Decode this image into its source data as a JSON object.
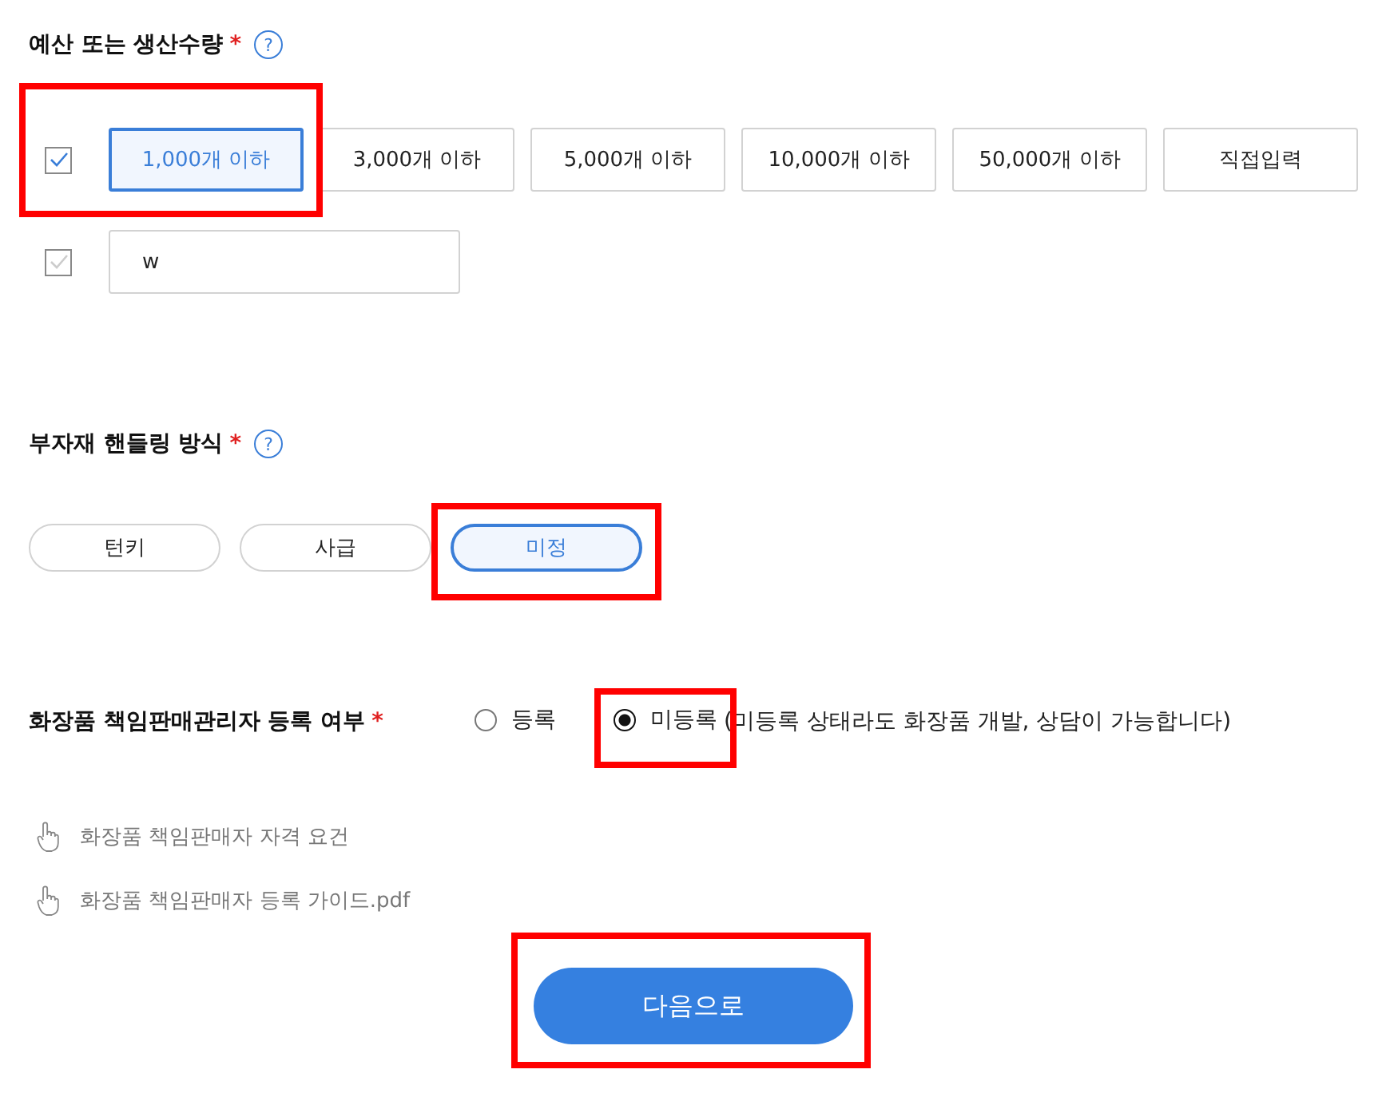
{
  "budget": {
    "title": "예산 또는 생산수량",
    "required": "*",
    "help": "?",
    "options": [
      {
        "label": "1,000개 이하",
        "selected": true
      },
      {
        "label": "3,000개 이하",
        "selected": false
      },
      {
        "label": "5,000개 이하",
        "selected": false
      },
      {
        "label": "10,000개 이하",
        "selected": false
      },
      {
        "label": "50,000개 이하",
        "selected": false
      },
      {
        "label": "직접입력",
        "selected": false
      }
    ],
    "preset_checked": true,
    "preset_highlighted": true,
    "custom": {
      "checked": false,
      "value": "w"
    }
  },
  "handling": {
    "title": "부자재 핸들링 방식",
    "required": "*",
    "help": "?",
    "options": [
      {
        "label": "턴키",
        "selected": false,
        "highlighted": false
      },
      {
        "label": "사급",
        "selected": false,
        "highlighted": false
      },
      {
        "label": "미정",
        "selected": true,
        "highlighted": true
      }
    ]
  },
  "registration": {
    "title": "화장품 책임판매관리자 등록 여부",
    "required": "*",
    "options": [
      {
        "label": "등록",
        "selected": false,
        "highlighted": false
      },
      {
        "label": "미등록",
        "selected": true,
        "highlighted": true
      }
    ],
    "note": "(미등록 상태라도 화장품 개발, 상담이 가능합니다)"
  },
  "links": [
    "화장품 책임판매자 자격 요건",
    "화장품 책임판매자 등록 가이드.pdf"
  ],
  "next_button": {
    "label": "다음으로",
    "highlighted": true
  }
}
